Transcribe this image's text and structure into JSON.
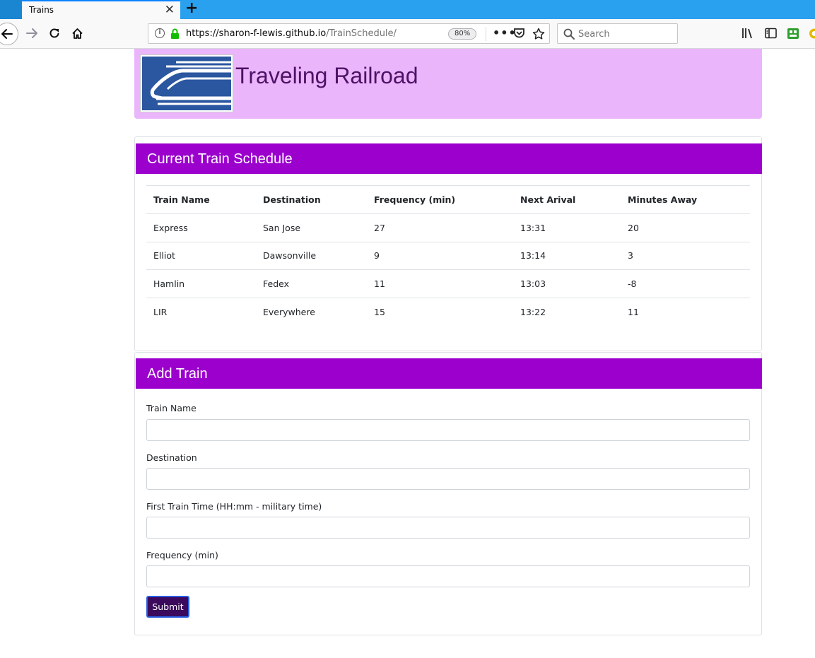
{
  "browser": {
    "tab_title": "Trains",
    "tab_close": "✕",
    "new_tab": "+",
    "url_host": "https://sharon-f-lewis.github.io",
    "url_path": "/TrainSchedule/",
    "zoom": "80%",
    "page_actions": "•••",
    "search_placeholder": "Search",
    "accent_color": "#2aa1ee"
  },
  "header": {
    "title": "Traveling Railroad",
    "background_color": "#ebb5fb",
    "title_color": "#4d1266"
  },
  "schedule": {
    "heading": "Current Train Schedule",
    "header_color": "#9b00cd",
    "columns": [
      "Train Name",
      "Destination",
      "Frequency (min)",
      "Next Arival",
      "Minutes Away"
    ],
    "rows": [
      [
        "Express",
        "San Jose",
        "27",
        "13:31",
        "20"
      ],
      [
        "Elliot",
        "Dawsonville",
        "9",
        "13:14",
        "3"
      ],
      [
        "Hamlin",
        "Fedex",
        "11",
        "13:03",
        "-8"
      ],
      [
        "LIR",
        "Everywhere",
        "15",
        "13:22",
        "11"
      ]
    ]
  },
  "add_train": {
    "heading": "Add Train",
    "fields": {
      "train_name": {
        "label": "Train Name",
        "value": ""
      },
      "destination": {
        "label": "Destination",
        "value": ""
      },
      "first_time": {
        "label": "First Train Time (HH:mm - military time)",
        "value": ""
      },
      "frequency": {
        "label": "Frequency (min)",
        "value": ""
      }
    },
    "submit_label": "Submit",
    "submit_color": "#3b0a5c"
  }
}
